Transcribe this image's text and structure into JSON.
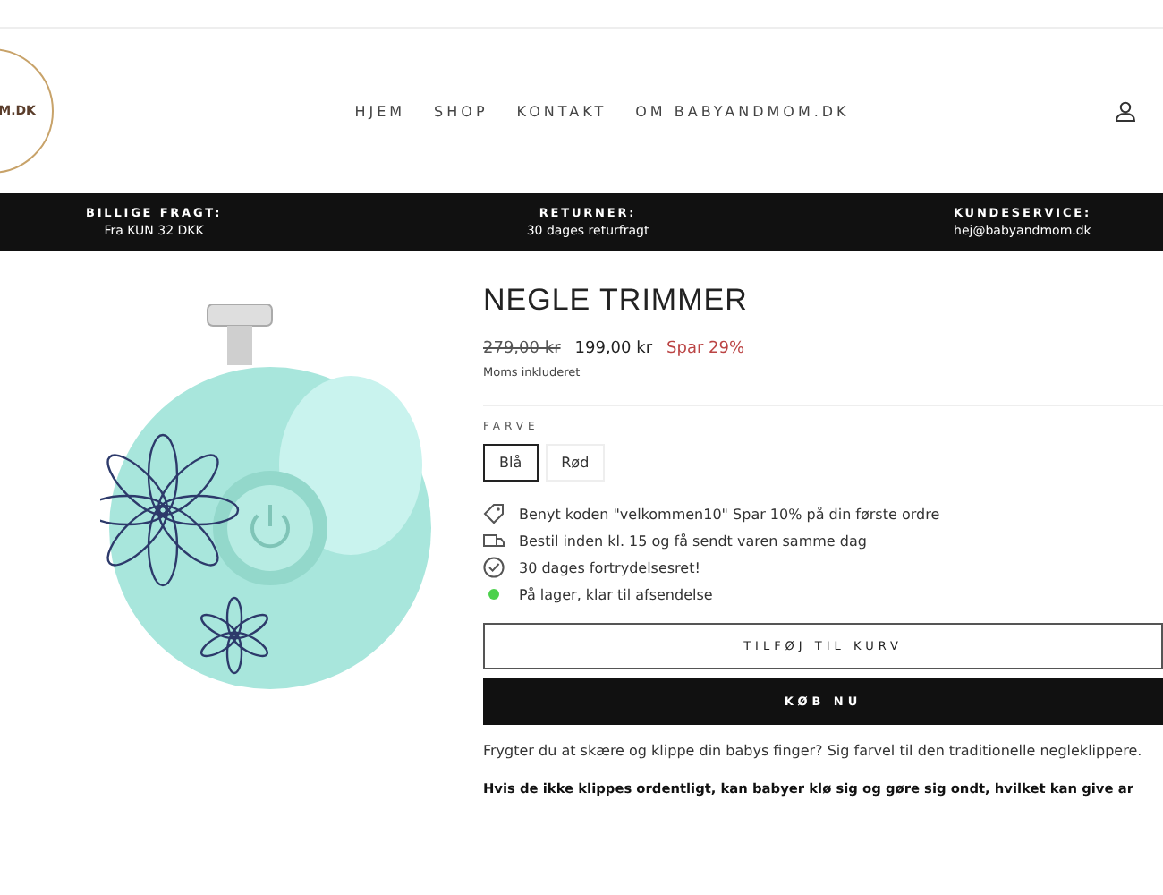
{
  "header": {
    "logo_text": "M.DK",
    "nav": [
      {
        "label": "HJEM"
      },
      {
        "label": "SHOP"
      },
      {
        "label": "KONTAKT"
      },
      {
        "label": "OM BABYANDMOM.DK"
      }
    ]
  },
  "info_bar": [
    {
      "title": "BILLIGE FRAGT:",
      "text": "Fra KUN 32 DKK"
    },
    {
      "title": "RETURNER:",
      "text": "30 dages returfragt"
    },
    {
      "title": "KUNDESERVICE:",
      "text": "hej@babyandmom.dk"
    }
  ],
  "product": {
    "title": "NEGLE TRIMMER",
    "old_price": "279,00 kr",
    "price": "199,00 kr",
    "saving": "Spar 29%",
    "tax_note": "Moms inkluderet",
    "option_label": "FARVE",
    "options": [
      {
        "label": "Blå",
        "selected": true
      },
      {
        "label": "Rød",
        "selected": false
      }
    ],
    "features": [
      {
        "kind": "tag",
        "text": "Benyt koden \"velkommen10\" Spar 10% på din første ordre"
      },
      {
        "kind": "truck",
        "text": "Bestil inden kl. 15 og få sendt varen samme dag"
      },
      {
        "kind": "check",
        "text": "30 dages fortrydelsesret!"
      },
      {
        "kind": "stock",
        "text": "På lager, klar til afsendelse",
        "color": "#4cd14c"
      }
    ],
    "add_to_cart": "TILFØJ TIL KURV",
    "buy_now": "KØB NU",
    "description": [
      {
        "kind": "plain",
        "text": "Frygter du at skære og klippe din babys finger? Sig farvel til den traditionelle negleklippere."
      },
      {
        "kind": "bold",
        "text": "Hvis de ikke klippes ordentligt, kan babyer klø sig og gøre sig ondt, hvilket kan give ar"
      }
    ]
  }
}
